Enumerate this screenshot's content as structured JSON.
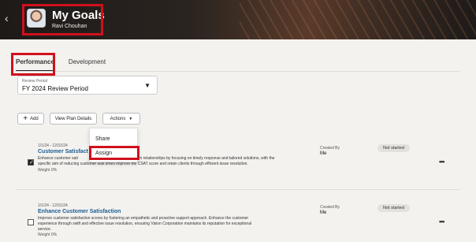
{
  "header": {
    "back_icon": "chevron-left-icon",
    "avatar_icon": "user-avatar-icon",
    "title": "My Goals",
    "subtitle": "Ravi Chouhan"
  },
  "tabs": [
    {
      "label": "Performance",
      "active": true
    },
    {
      "label": "Development",
      "active": false
    }
  ],
  "review_period": {
    "label": "Review Period",
    "value": "FY 2024 Review Period"
  },
  "toolbar": {
    "add_label": "Add",
    "view_plan_label": "View Plan Details",
    "actions_label": "Actions"
  },
  "actions_menu": {
    "items": [
      "Share",
      "Assign"
    ]
  },
  "goals": [
    {
      "checked": true,
      "dates": "1/1/24 - 12/31/24",
      "title": "Customer Satisfact",
      "desc1": "Enhance customer sati",
      "desc1b": "term relationships by focusing on timely response and tailored solutions, with the",
      "desc2": "specific aim of reducing customer wait times improve the CSAT score and retain clients through efficient issue resolution.",
      "weight": "Weight 0%",
      "created_by_label": "Created By",
      "created_by": "Me",
      "status": "Not started"
    },
    {
      "checked": false,
      "dates": "1/1/24 - 12/31/24",
      "title": "Enhance Customer Satisfaction",
      "desc1": "Improve customer satisfaction scores by fostering an empathetic and proactive support approach. Enhance the customer",
      "desc2": "experience through swift and effective issue resolution, ensuring Vision Corporation maintains its reputation for exceptional",
      "desc3": "service.",
      "weight": "Weight 0%",
      "created_by_label": "Created By",
      "created_by": "Me",
      "status": "Not started"
    }
  ],
  "colors": {
    "highlight": "#d0101d",
    "goal_title": "#1a5d92"
  }
}
